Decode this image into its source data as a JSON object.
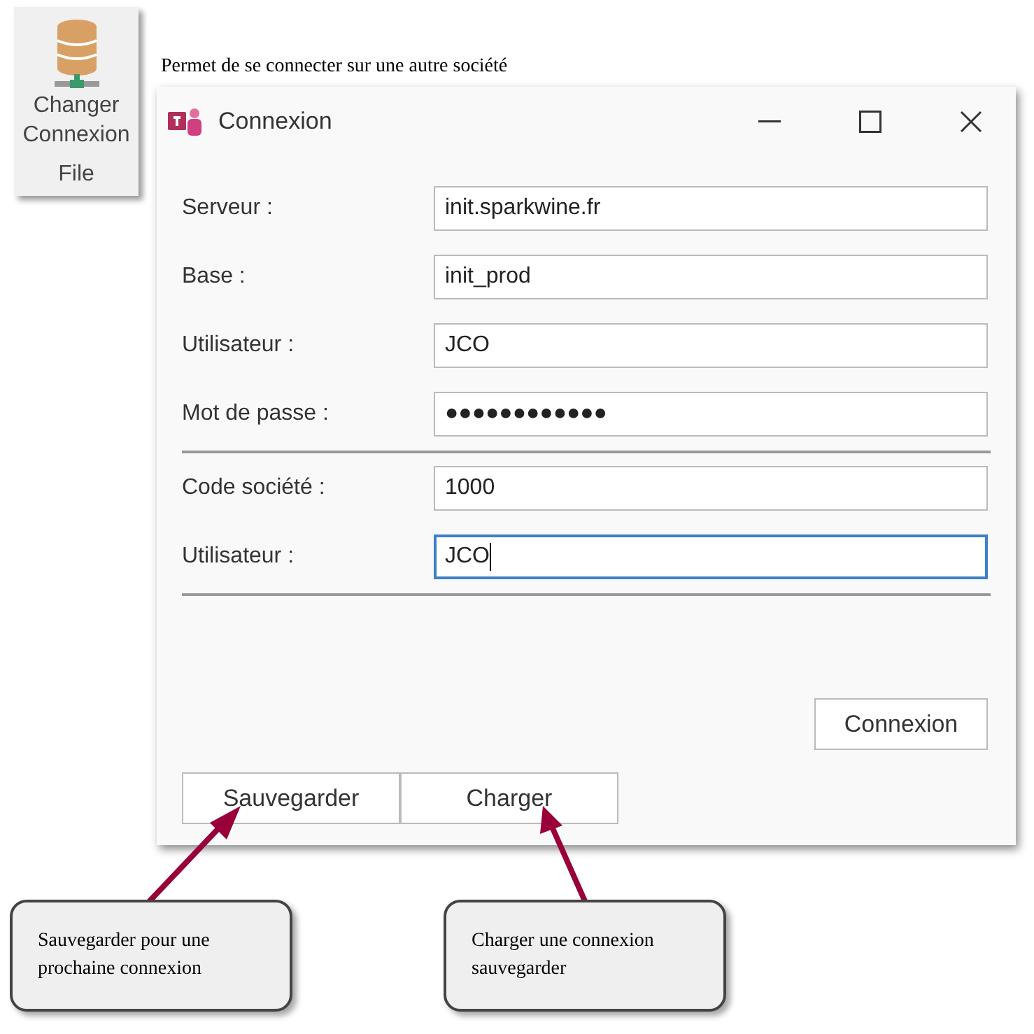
{
  "ribbon_button": {
    "label": "Changer Connexion",
    "group": "File"
  },
  "caption": "Permet de se connecter sur une autre société",
  "window": {
    "title": "Connexion"
  },
  "field_groups": [
    {
      "fields": [
        {
          "label": "Serveur :",
          "value": "init.sparkwine.fr",
          "focused": false
        },
        {
          "label": "Base :",
          "value": "init_prod",
          "focused": false
        },
        {
          "label": "Utilisateur :",
          "value": "JCO",
          "focused": false
        },
        {
          "label": "Mot de passe :",
          "value": "●●●●●●●●●●●●",
          "focused": false
        }
      ]
    },
    {
      "fields": [
        {
          "label": "Code société :",
          "value": "1000",
          "focused": false
        },
        {
          "label": "Utilisateur :",
          "value": "JCO",
          "focused": true
        }
      ]
    }
  ],
  "connect_button": "Connexion",
  "bottom_buttons": [
    "Sauvegarder",
    "Charger"
  ],
  "callouts": [
    {
      "text": "Sauvegarder pour une prochaine connexion"
    },
    {
      "text": "Charger une connexion sauvegarder"
    }
  ]
}
